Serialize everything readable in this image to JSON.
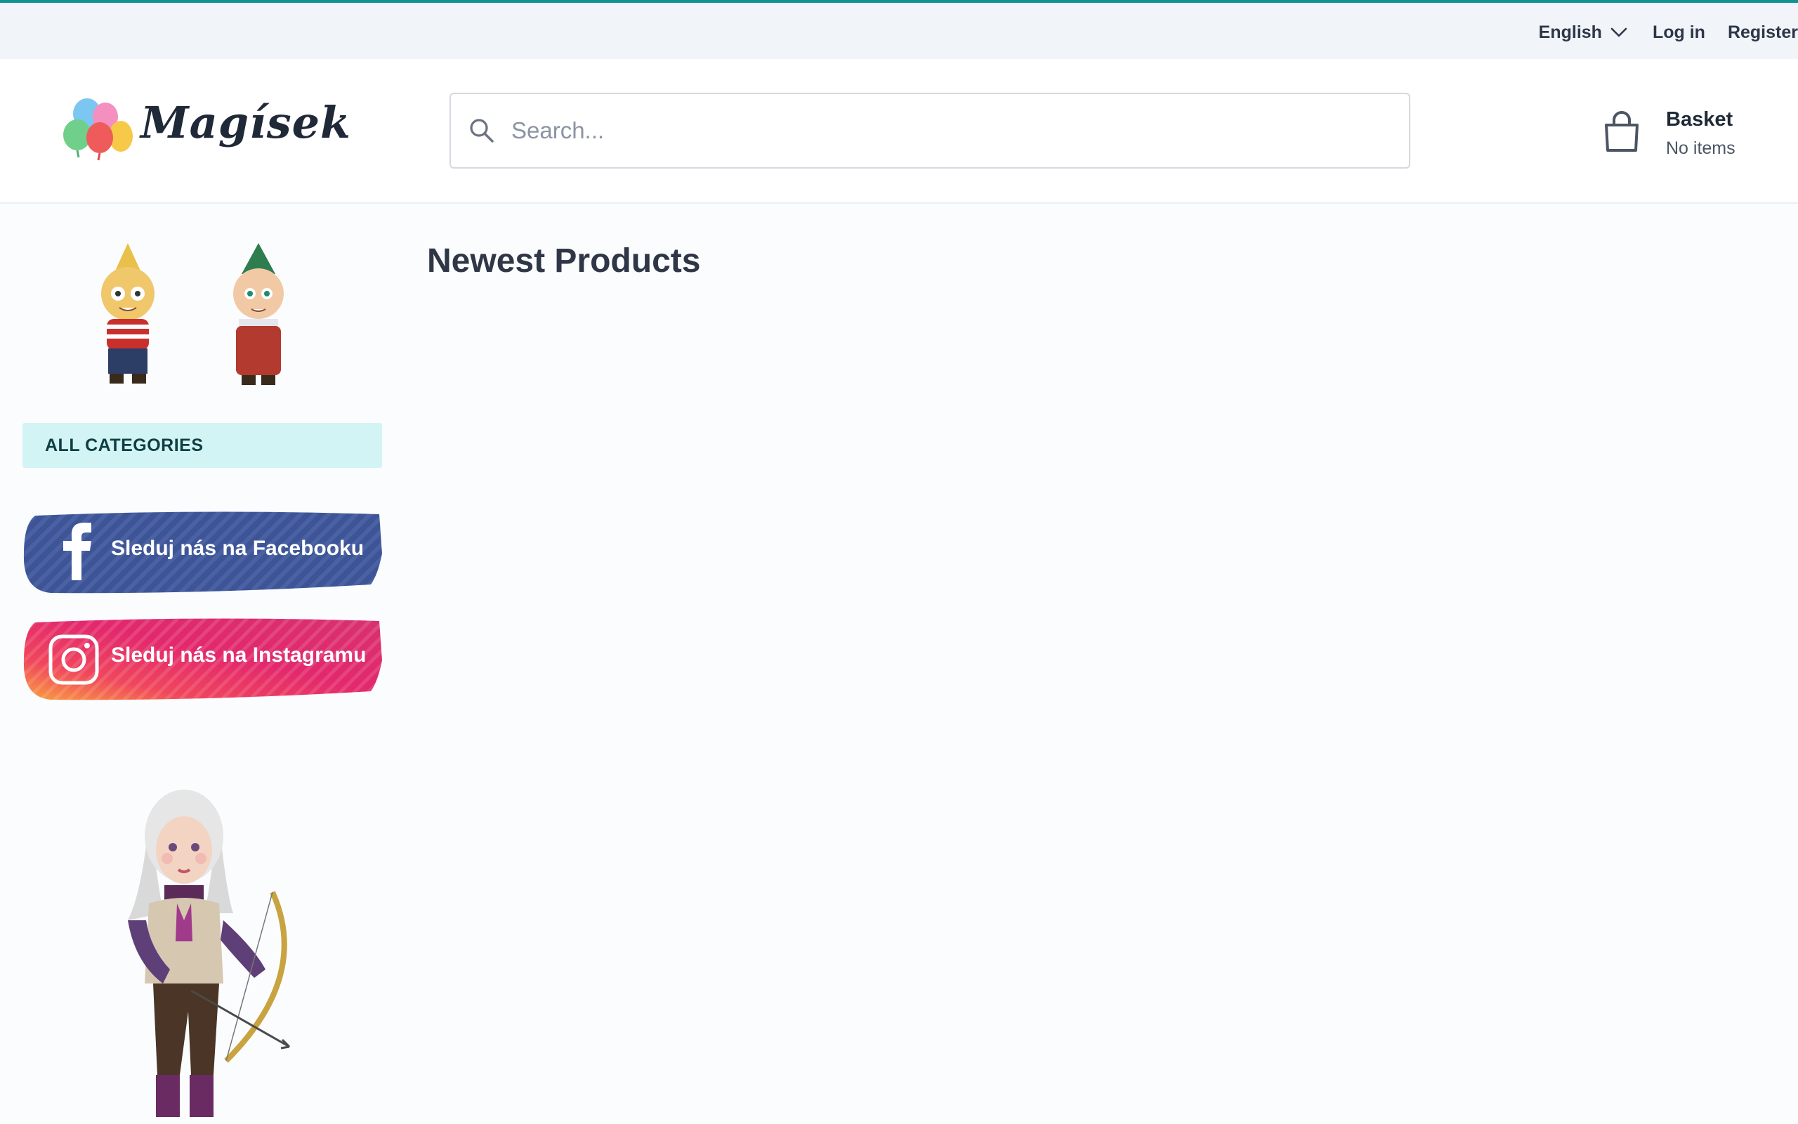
{
  "topbar": {
    "language": "English",
    "login": "Log in",
    "register": "Register"
  },
  "header": {
    "logo_text": "Magísek",
    "search_placeholder": "Search...",
    "basket_title": "Basket",
    "basket_status": "No items"
  },
  "sidebar": {
    "categories_label": "ALL CATEGORIES",
    "facebook_label": "Sleduj nás na Facebooku",
    "instagram_label": "Sleduj nás na Instagramu"
  },
  "main": {
    "title": "Newest Products"
  },
  "colors": {
    "accent_teal": "#0e9394",
    "category_bg": "#d3f4f4",
    "facebook_blue": "#3d5597",
    "instagram_pink": "#e3286d"
  },
  "icons": [
    "chevron-down-icon",
    "search-icon",
    "shopping-bag-icon",
    "facebook-icon",
    "instagram-icon",
    "balloons-icon"
  ]
}
